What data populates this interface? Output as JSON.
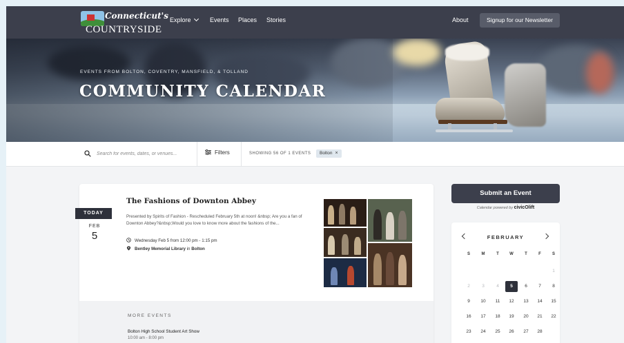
{
  "nav": {
    "logo_script": "Connecticut's",
    "logo_main": "COUNTRYSIDE",
    "items": [
      "Explore",
      "Events",
      "Places",
      "Stories"
    ],
    "about": "About",
    "newsletter": "Signup for our Newsletter"
  },
  "hero": {
    "kicker": "EVENTS FROM BOLTON, COVENTRY, MANSFIELD, & TOLLAND",
    "title": "COMMUNITY CALENDAR"
  },
  "filter_bar": {
    "search_placeholder": "Search for events, dates, or venues...",
    "filters_label": "Filters",
    "showing": "SHOWING 56 OF 1 EVENTS",
    "chip": "Bolton",
    "chip_close": "×"
  },
  "event": {
    "badge": "TODAY",
    "month": "FEB",
    "day": "5",
    "title": "The Fashions of Downton Abbey",
    "description": "Presented by Spirits of Fashion - Rescheduled February 5th at noon! &nbsp; Are you a fan of Downton Abbey?&nbsp;Would you love to know more about the fashions of the...",
    "when": "Wednesday Feb 5 from 12:00 pm - 1:15 pm",
    "venue": "Bentley Memorial Library",
    "venue_sep": "in",
    "town": "Bolton"
  },
  "more": {
    "heading": "MORE EVENTS",
    "items": [
      {
        "title": "Bolton High School Student Art Show",
        "time": "10:00 am - 8:00 pm"
      }
    ]
  },
  "sidebar": {
    "submit": "Submit an Event",
    "powered_text": "Calendar powered by",
    "powered_brand": "civicOlift",
    "calendar": {
      "month": "FEBRUARY",
      "weekdays": [
        "S",
        "M",
        "T",
        "W",
        "T",
        "F",
        "S"
      ],
      "selected": "5",
      "weeks": [
        [
          "",
          "",
          "",
          "",
          "",
          "",
          "1"
        ],
        [
          "2",
          "3",
          "4",
          "5",
          "6",
          "7",
          "8"
        ],
        [
          "9",
          "10",
          "11",
          "12",
          "13",
          "14",
          "15"
        ],
        [
          "16",
          "17",
          "18",
          "19",
          "20",
          "21",
          "22"
        ],
        [
          "23",
          "24",
          "25",
          "26",
          "27",
          "28",
          ""
        ]
      ]
    }
  },
  "colors": {
    "nav_bg": "#3c3f4c",
    "accent_dark": "#2e313b",
    "page_bg": "#f3f4f6",
    "chip_bg": "#dfe7ee"
  }
}
